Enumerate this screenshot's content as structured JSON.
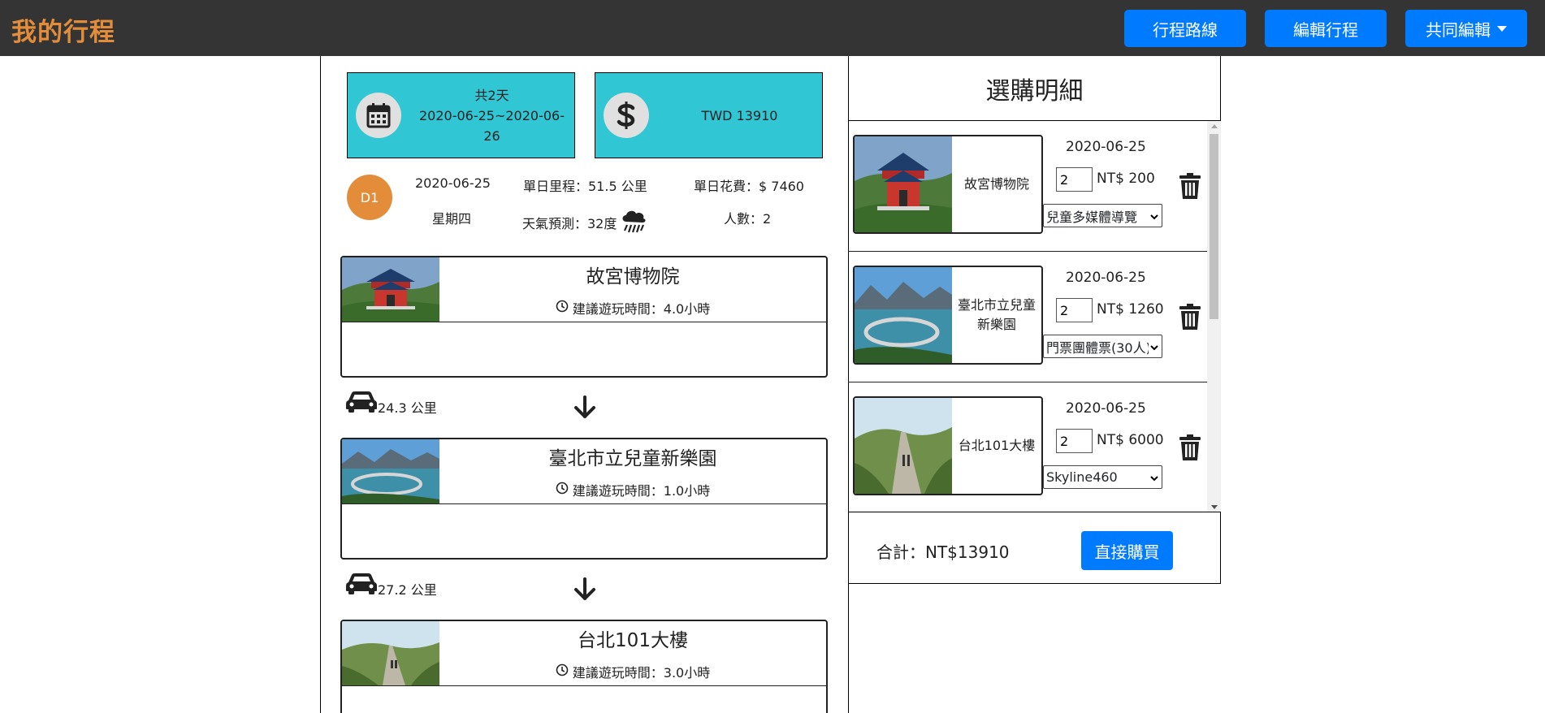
{
  "header": {
    "brand": "我的行程",
    "buttons": {
      "route": "行程路線",
      "edit": "編輯行程",
      "share": "共同編輯"
    }
  },
  "summary": {
    "days": "共2天",
    "date_range": "2020-06-25~2020-06-26",
    "total_cost": "TWD 13910",
    "calendar_icon": "calendar-icon",
    "dollar_icon": "dollar-icon"
  },
  "day": {
    "badge": "D1",
    "date": "2020-06-25",
    "weekday": "星期四",
    "distance": "單日里程：51.5 公里",
    "weather": "天氣預測：32度",
    "cost": "單日花費：$ 7460",
    "people": "人數：2"
  },
  "spots": [
    {
      "title": "故宮博物院",
      "time": "建議遊玩時間：4.0小時"
    },
    {
      "title": "臺北市立兒童新樂園",
      "time": "建議遊玩時間：1.0小時"
    },
    {
      "title": "台北101大樓",
      "time": "建議遊玩時間：3.0小時"
    }
  ],
  "transfers": [
    {
      "distance": "24.3 公里"
    },
    {
      "distance": "27.2 公里"
    }
  ],
  "cart": {
    "title": "選購明細",
    "items": [
      {
        "name": "故宮博物院",
        "date": "2020-06-25",
        "qty": "2",
        "price": "NT$ 200",
        "option": "兒童多媒體導覽"
      },
      {
        "name": "臺北市立兒童新樂園",
        "date": "2020-06-25",
        "qty": "2",
        "price": "NT$ 1260",
        "option": "門票團體票(30人)"
      },
      {
        "name": "台北101大樓",
        "date": "2020-06-25",
        "qty": "2",
        "price": "NT$ 6000",
        "option": "Skyline460"
      }
    ],
    "total": "合計：NT$13910",
    "buy_label": "直接購買"
  },
  "colors": {
    "navbar": "#343434",
    "brand": "#e38d3a",
    "primary": "#007bff",
    "info_box": "#31c6d4",
    "day_badge": "#e38d3a"
  }
}
